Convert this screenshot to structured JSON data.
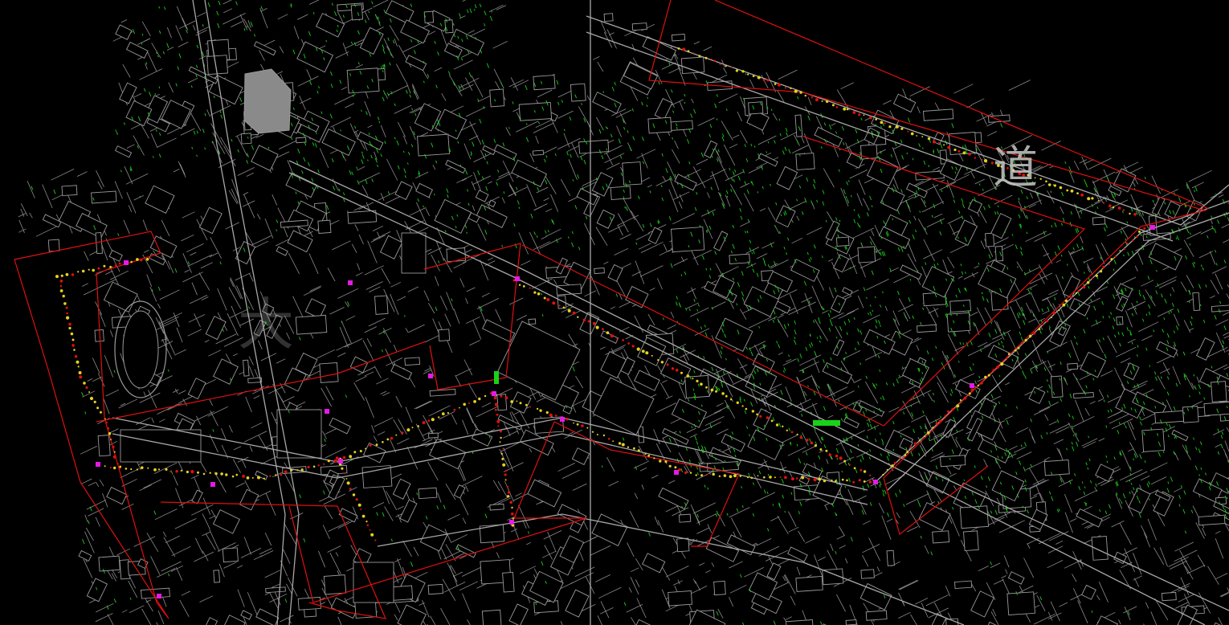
{
  "map": {
    "labels": {
      "road_character": "道",
      "ghost_character": "大"
    },
    "colors": {
      "background": "#000000",
      "linework": "#8c8c8c",
      "vegetation": "#19d219",
      "boundary": "#e01010",
      "markers": "#e6d21e",
      "highlight": "#e619e6",
      "building_fill": "#000000",
      "plaza_fill": "#8a8a8a"
    }
  }
}
